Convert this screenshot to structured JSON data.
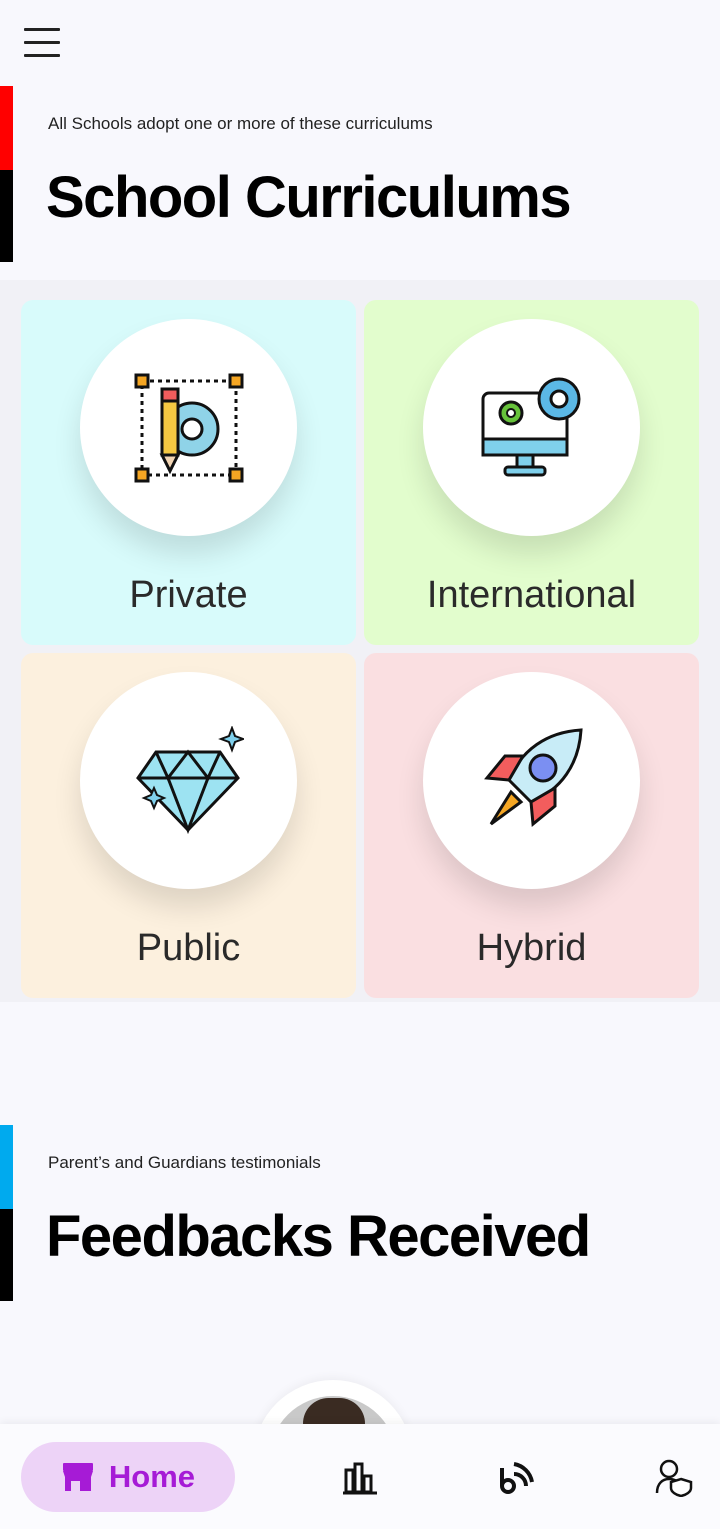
{
  "topbar": {
    "menu_icon": "hamburger-menu-icon"
  },
  "curriculums": {
    "subtitle": "All Schools adopt one or more of these curriculums",
    "title": "School Curriculums",
    "accent_color": "#ff0000",
    "cards": [
      {
        "label": "Private",
        "icon": "design-gear-pencil-icon",
        "color": "#d8fbfb"
      },
      {
        "label": "International",
        "icon": "computer-gears-icon",
        "color": "#e2fdcd"
      },
      {
        "label": "Public",
        "icon": "diamond-icon",
        "color": "#fcf0de"
      },
      {
        "label": "Hybrid",
        "icon": "rocket-icon",
        "color": "#fadfe1"
      }
    ]
  },
  "feedbacks": {
    "subtitle": "Parent’s  and Guardians testimonials",
    "title": "Feedbacks Received",
    "accent_color": "#00aaee"
  },
  "bottom_nav": {
    "home_label": "Home",
    "active_color": "#a61bd6",
    "items": [
      "home-store-icon",
      "stats-bar-icon",
      "blog-feed-icon",
      "user-shield-icon"
    ]
  }
}
